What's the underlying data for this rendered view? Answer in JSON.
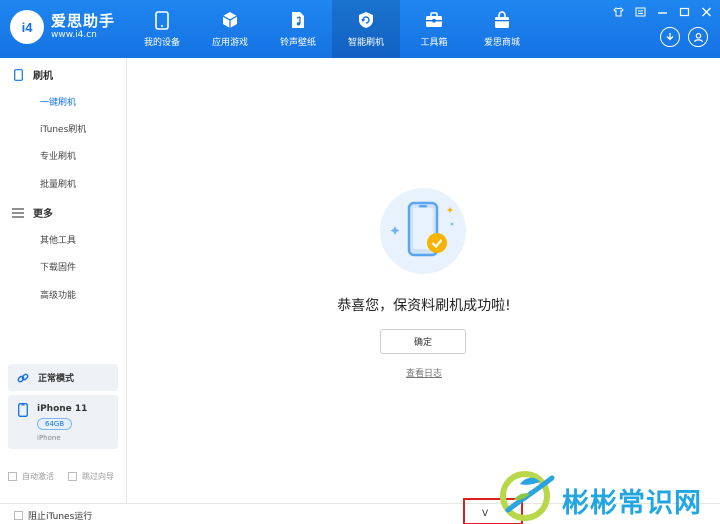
{
  "app": {
    "logo_badge": "i4",
    "name": "爱思助手",
    "url": "www.i4.cn"
  },
  "nav": [
    {
      "label": "我的设备",
      "icon": "phone-icon"
    },
    {
      "label": "应用游戏",
      "icon": "cube-icon"
    },
    {
      "label": "铃声壁纸",
      "icon": "music-file-icon"
    },
    {
      "label": "智能刷机",
      "icon": "refresh-shield-icon"
    },
    {
      "label": "工具箱",
      "icon": "toolbox-icon"
    },
    {
      "label": "爱思商城",
      "icon": "bag-icon"
    }
  ],
  "sidebar": {
    "flash_section": "刷机",
    "flash_items": [
      "一键刷机",
      "iTunes刷机",
      "专业刷机",
      "批量刷机"
    ],
    "more_section": "更多",
    "more_items": [
      "其他工具",
      "下载固件",
      "高级功能"
    ],
    "mode_label": "正常模式",
    "device_name": "iPhone 11",
    "device_capacity": "64GB",
    "device_type": "iPhone",
    "auto_activate": "自动激活",
    "skip_guide": "跳过向导"
  },
  "main": {
    "success_title": "恭喜您，保资料刷机成功啦!",
    "ok_button": "确定",
    "log_link": "查看日志"
  },
  "bottom": {
    "itunes_block": "阻止iTunes运行",
    "version_prefix": "V"
  },
  "watermark": {
    "text": "彬彬常识网"
  },
  "colors": {
    "accent": "#1572e3",
    "success": "#f6b400",
    "highlight_border": "#e02020"
  }
}
